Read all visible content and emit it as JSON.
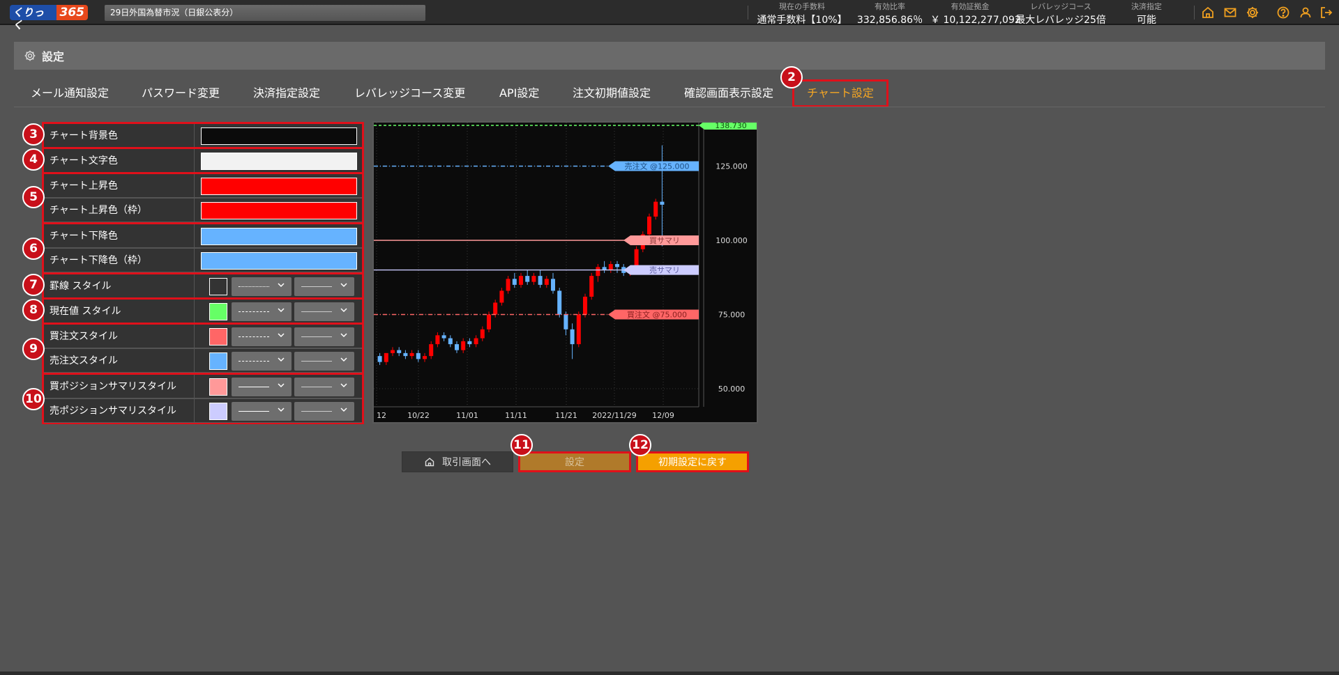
{
  "header": {
    "logo_part1": "くりっく",
    "logo_part2": "365",
    "ticker": "29日外国為替市況（日銀公表分）",
    "stats": [
      {
        "label": "現在の手数料",
        "value": "通常手数料【10%】"
      },
      {
        "label": "有効比率",
        "value": "332,856.86％"
      },
      {
        "label": "有効証拠金",
        "value": "￥ 10,122,277,092"
      },
      {
        "label": "レバレッジコース",
        "value": "最大レバレッジ25倍"
      },
      {
        "label": "決済指定",
        "value": "可能"
      }
    ],
    "icons": [
      "home-icon",
      "mail-icon",
      "gear-icon",
      "help-icon",
      "user-icon",
      "logout-icon"
    ],
    "accent": "#f0a020"
  },
  "settings": {
    "title": "設定"
  },
  "tabs": [
    {
      "label": "メール通知設定"
    },
    {
      "label": "パスワード変更"
    },
    {
      "label": "決済指定設定"
    },
    {
      "label": "レバレッジコース変更"
    },
    {
      "label": "API設定"
    },
    {
      "label": "注文初期値設定"
    },
    {
      "label": "確認画面表示設定"
    },
    {
      "label": "チャート設定",
      "active": true
    }
  ],
  "badges": [
    "2",
    "3",
    "4",
    "5",
    "6",
    "7",
    "8",
    "9",
    "10",
    "11",
    "12"
  ],
  "rows": [
    {
      "label": "チャート背景色",
      "color": "#0b0b0b"
    },
    {
      "label": "チャート文字色",
      "color": "#f2f2f2"
    },
    {
      "label": "チャート上昇色",
      "color": "#ff0000"
    },
    {
      "label": "チャート上昇色（枠）",
      "color": "#ff0000"
    },
    {
      "label": "チャート下降色",
      "color": "#66b3ff"
    },
    {
      "label": "チャート下降色（枠）",
      "color": "#66b3ff"
    },
    {
      "label": "罫線 スタイル",
      "color": "#333333"
    },
    {
      "label": "現在値 スタイル",
      "color": "#66ff66"
    },
    {
      "label": "買注文スタイル",
      "color": "#ff6666"
    },
    {
      "label": "売注文スタイル",
      "color": "#66b3ff"
    },
    {
      "label": "買ポジションサマリスタイル",
      "color": "#ff9999"
    },
    {
      "label": "売ポジションサマリスタイル",
      "color": "#ccccff"
    }
  ],
  "chart": {
    "current_price": "138.730",
    "sell_order_label": "売注文 @125.000",
    "buy_summary_label": "買サマリ",
    "sell_summary_label": "売サマリ",
    "buy_order_label": "買注文 @75.000",
    "colors": {
      "background": "#0b0b0b",
      "up": "#ff0000",
      "down": "#66b3ff",
      "current": "#66ff66",
      "buy_order": "#ff6666",
      "sell_order": "#66b3ff",
      "buy_summary": "#ff9999",
      "sell_summary": "#ccccff"
    }
  },
  "chart_data": {
    "type": "candlestick",
    "title": "",
    "xlabel": "",
    "ylabel": "",
    "x_ticks": [
      "12",
      "10/22",
      "11/01",
      "11/11",
      "11/21",
      "2022/11/29",
      "12/09"
    ],
    "y_ticks": [
      "125.000",
      "100.000",
      "75.000",
      "50.000"
    ],
    "ylim": [
      45,
      138.73
    ],
    "lines": [
      {
        "name": "current",
        "value": 138.73
      },
      {
        "name": "sell_order",
        "value": 125
      },
      {
        "name": "buy_summary",
        "value": 100
      },
      {
        "name": "sell_summary",
        "value": 90
      },
      {
        "name": "buy_order",
        "value": 75
      }
    ],
    "ohlc": [
      [
        61,
        62,
        58,
        59
      ],
      [
        59,
        62,
        58,
        62
      ],
      [
        62,
        64,
        61,
        63
      ],
      [
        63,
        64,
        61,
        62
      ],
      [
        62,
        63,
        60,
        61
      ],
      [
        61,
        63,
        60,
        62
      ],
      [
        62,
        63,
        59,
        60
      ],
      [
        60,
        62,
        59,
        61
      ],
      [
        61,
        66,
        60,
        65
      ],
      [
        65,
        69,
        64,
        68
      ],
      [
        68,
        69,
        66,
        67
      ],
      [
        67,
        68,
        64,
        65
      ],
      [
        65,
        66,
        62,
        63
      ],
      [
        63,
        67,
        62,
        66
      ],
      [
        66,
        67,
        64,
        65
      ],
      [
        65,
        68,
        64,
        67
      ],
      [
        67,
        71,
        66,
        70
      ],
      [
        70,
        76,
        69,
        75
      ],
      [
        75,
        80,
        74,
        79
      ],
      [
        79,
        84,
        78,
        83
      ],
      [
        83,
        88,
        82,
        87
      ],
      [
        87,
        89,
        84,
        85
      ],
      [
        85,
        89,
        84,
        88
      ],
      [
        88,
        90,
        85,
        86
      ],
      [
        86,
        89,
        85,
        88
      ],
      [
        88,
        90,
        84,
        85
      ],
      [
        85,
        88,
        84,
        87
      ],
      [
        87,
        89,
        82,
        83
      ],
      [
        83,
        84,
        74,
        75
      ],
      [
        75,
        76,
        68,
        70
      ],
      [
        70,
        72,
        60,
        65
      ],
      [
        65,
        76,
        64,
        75
      ],
      [
        75,
        82,
        74,
        81
      ],
      [
        81,
        89,
        80,
        88
      ],
      [
        88,
        92,
        86,
        91
      ],
      [
        91,
        93,
        89,
        90
      ],
      [
        90,
        93,
        89,
        92
      ],
      [
        92,
        93,
        89,
        91
      ],
      [
        91,
        92,
        88,
        89
      ],
      [
        89,
        91,
        88,
        90
      ],
      [
        90,
        98,
        89,
        97
      ],
      [
        97,
        103,
        96,
        102
      ],
      [
        102,
        109,
        101,
        108
      ],
      [
        108,
        114,
        107,
        113
      ],
      [
        113,
        132,
        98,
        112
      ]
    ]
  },
  "buttons": {
    "home": "取引画面へ",
    "set": "設定",
    "reset": "初期設定に戻す"
  }
}
